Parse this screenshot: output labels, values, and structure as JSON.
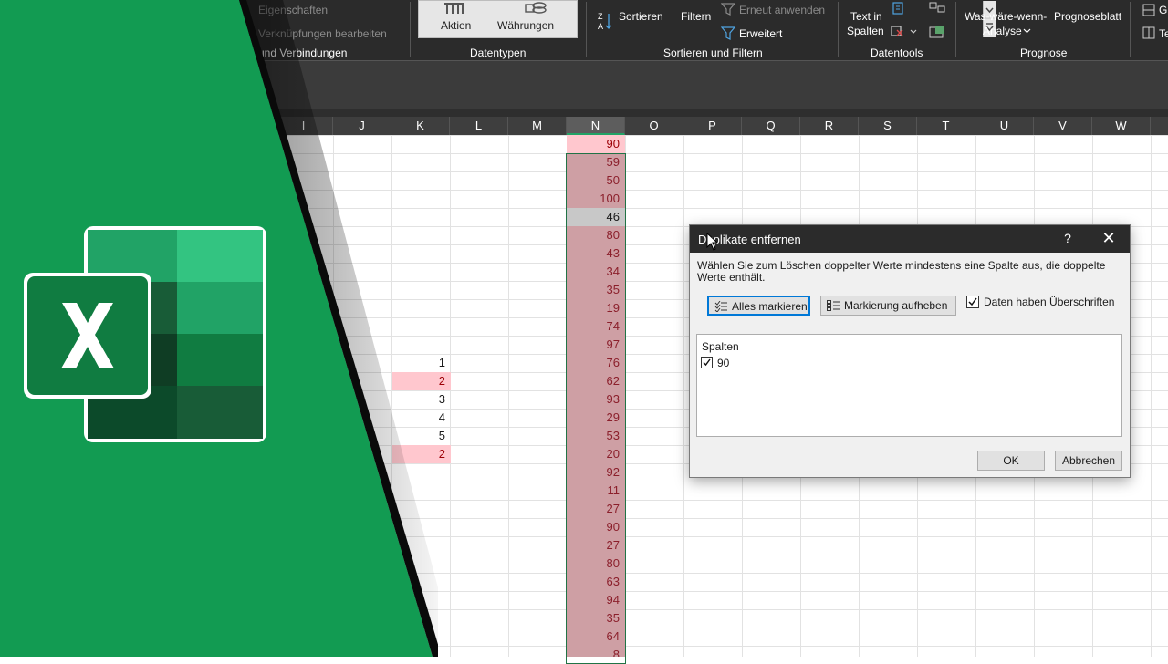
{
  "ribbon": {
    "conn_items": [
      "Eigenschaften",
      "Verknüpfungen bearbeiten"
    ],
    "group_queries": "und Verbindungen",
    "datatypes": {
      "stocks": "Aktien",
      "currencies": "Währungen",
      "label": "Datentypen"
    },
    "sort_filter": {
      "sort": "Sortieren",
      "filter": "Filtern",
      "reapply": "Erneut anwenden",
      "advanced": "Erweitert",
      "label": "Sortieren und Filtern"
    },
    "datatools": {
      "text_to_columns_1": "Text in",
      "text_to_columns_2": "Spalten",
      "label": "Datentools"
    },
    "forecast": {
      "whatif_1": "Was-wäre-wenn-",
      "whatif_2": "Analyse",
      "sheet": "Prognoseblatt",
      "label": "Prognose"
    },
    "outline": {
      "group": "G",
      "ungroup": "Te"
    }
  },
  "grid": {
    "columns": [
      "I",
      "J",
      "K",
      "L",
      "M",
      "N",
      "O",
      "P",
      "Q",
      "R",
      "S",
      "T",
      "U",
      "V",
      "W"
    ],
    "selected_column": "N",
    "n_values": [
      "90",
      "59",
      "50",
      "100",
      "46",
      "80",
      "43",
      "34",
      "35",
      "19",
      "74",
      "97",
      "76",
      "62",
      "93",
      "29",
      "53",
      "20",
      "92",
      "11",
      "27",
      "90",
      "27",
      "80",
      "63",
      "94",
      "35",
      "64",
      "8"
    ],
    "k_values": [
      "1",
      "2",
      "3",
      "4",
      "5",
      "2"
    ]
  },
  "dialog": {
    "title": "Duplikate entfernen",
    "help": "?",
    "close": "✕",
    "description": "Wählen Sie zum Löschen doppelter Werte mindestens eine Spalte aus, die doppelte Werte enthält.",
    "select_all": "Alles markieren",
    "unselect_all": "Markierung aufheben",
    "has_headers": "Daten haben Überschriften",
    "has_headers_checked": true,
    "columns_label": "Spalten",
    "column_items": [
      {
        "label": "90",
        "checked": true
      }
    ],
    "ok": "OK",
    "cancel": "Abbrechen"
  },
  "colors": {
    "excel_green": "#21a366",
    "dup_fill": "#ffc7ce",
    "dup_text": "#9c0006",
    "ribbon_bg": "#2b2b2b"
  }
}
